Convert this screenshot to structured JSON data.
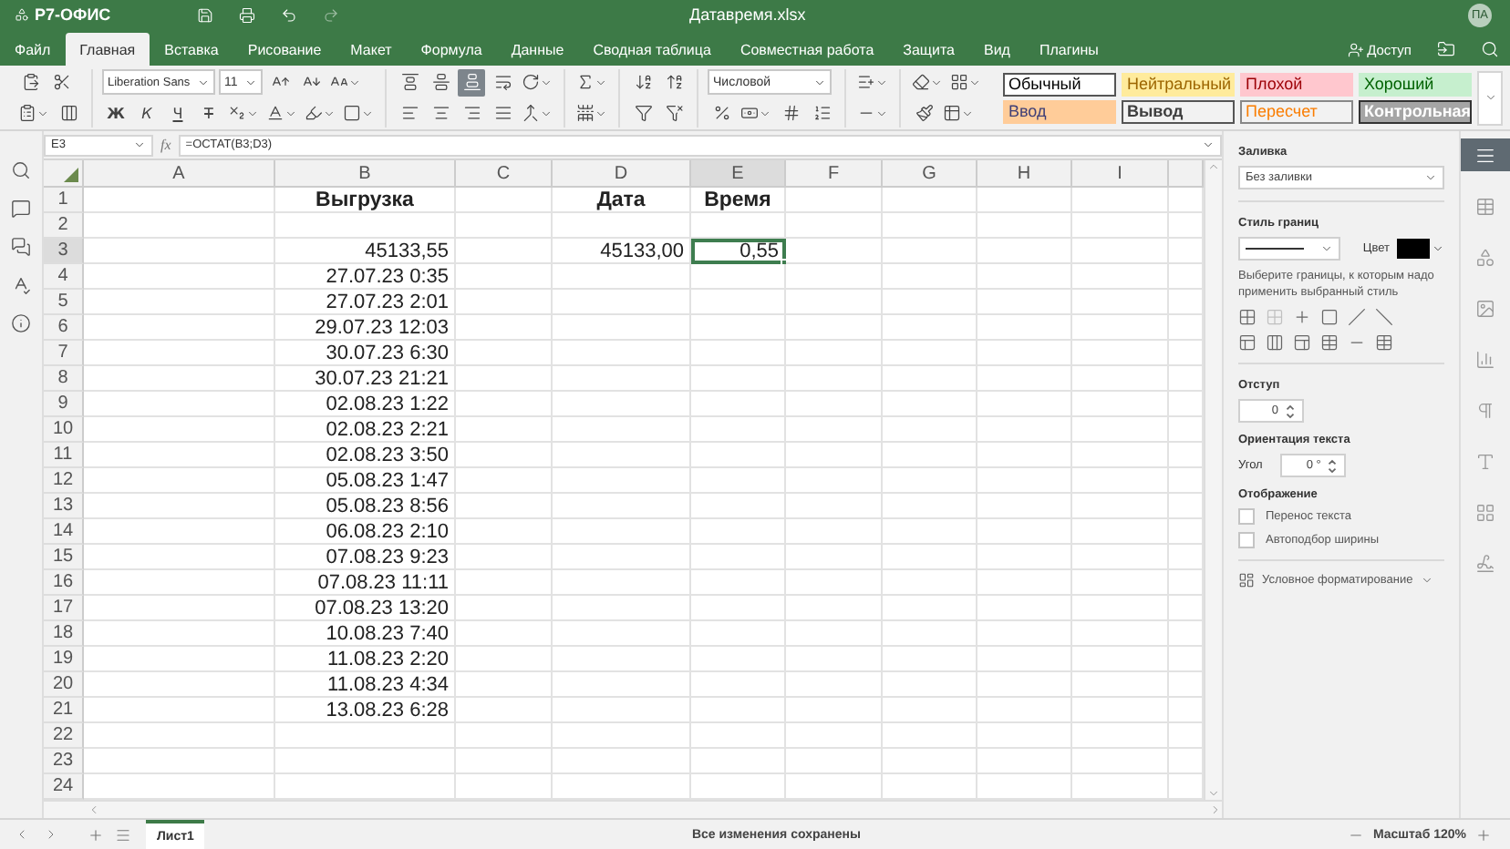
{
  "title_bar": {
    "app_name": "Р7-ОФИС",
    "document": "Датавремя.xlsx",
    "avatar": "ПА"
  },
  "menu_tabs": [
    {
      "label": "Файл",
      "selected": false
    },
    {
      "label": "Главная",
      "selected": true
    },
    {
      "label": "Вставка",
      "selected": false
    },
    {
      "label": "Рисование",
      "selected": false
    },
    {
      "label": "Макет",
      "selected": false
    },
    {
      "label": "Формула",
      "selected": false
    },
    {
      "label": "Данные",
      "selected": false
    },
    {
      "label": "Сводная таблица",
      "selected": false
    },
    {
      "label": "Совместная работа",
      "selected": false
    },
    {
      "label": "Защита",
      "selected": false
    },
    {
      "label": "Вид",
      "selected": false
    },
    {
      "label": "Плагины",
      "selected": false
    }
  ],
  "share_button": {
    "label": "Доступ"
  },
  "toolbar": {
    "font_name": "Liberation Sans",
    "font_size": "11",
    "format_letters": [
      "Ж",
      "К",
      "Ч",
      "Т"
    ],
    "vertical_align_buttons": [
      {
        "kind": "top",
        "selected": false
      },
      {
        "kind": "middle",
        "selected": false
      },
      {
        "kind": "bottom",
        "selected": true
      }
    ],
    "number_format": "Числовой",
    "cell_styles": [
      {
        "label": "Обычный",
        "color": "#ffffff",
        "kind": "normal"
      },
      {
        "label": "Нейтральный",
        "color": "#ffeb9c",
        "kind": "neutral"
      },
      {
        "label": "Плохой",
        "color": "#ffc7ce",
        "kind": "bad"
      },
      {
        "label": "Хороший",
        "color": "#c6efce",
        "kind": "good"
      },
      {
        "label": "Ввод",
        "color": "#ffcc99",
        "kind": "input"
      },
      {
        "label": "Вывод",
        "color": "#f2f2f2",
        "kind": "output"
      },
      {
        "label": "Пересчет",
        "color": "#f2f2f2",
        "kind": "calculation"
      },
      {
        "label": "Контрольная",
        "color": "#a5a5a5",
        "kind": "check"
      }
    ]
  },
  "formula_bar": {
    "cell": "E3",
    "fx": "fx",
    "formula": "=ОСТАТ(B3;D3)"
  },
  "sheet": {
    "columns": [
      {
        "letter": "A",
        "selected": false
      },
      {
        "letter": "B",
        "selected": false
      },
      {
        "letter": "C",
        "selected": false
      },
      {
        "letter": "D",
        "selected": false
      },
      {
        "letter": "E",
        "selected": true
      },
      {
        "letter": "F",
        "selected": false
      },
      {
        "letter": "G",
        "selected": false
      },
      {
        "letter": "H",
        "selected": false
      },
      {
        "letter": "I",
        "selected": false
      }
    ],
    "rows": [
      {
        "number": "1",
        "selected": false,
        "cells": {
          "B": {
            "text": "Выгрузка",
            "kind": "header",
            "selected": false
          },
          "D": {
            "text": "Дата",
            "kind": "header",
            "selected": false
          },
          "E": {
            "text": "Время",
            "kind": "header",
            "selected": false
          }
        }
      },
      {
        "number": "2",
        "selected": false
      },
      {
        "number": "3",
        "selected": true,
        "cells": {
          "B": {
            "text": "45133,55",
            "kind": "value",
            "selected": false
          },
          "D": {
            "text": "45133,00",
            "kind": "value",
            "selected": false
          },
          "E": {
            "text": "0,55",
            "kind": "value",
            "selected": true
          }
        }
      },
      {
        "number": "4",
        "selected": false,
        "cells": {
          "B": {
            "text": "27.07.23 0:35",
            "kind": "value",
            "selected": false
          }
        }
      },
      {
        "number": "5",
        "selected": false,
        "cells": {
          "B": {
            "text": "27.07.23 2:01",
            "kind": "value",
            "selected": false
          }
        }
      },
      {
        "number": "6",
        "selected": false,
        "cells": {
          "B": {
            "text": "29.07.23 12:03",
            "kind": "value",
            "selected": false
          }
        }
      },
      {
        "number": "7",
        "selected": false,
        "cells": {
          "B": {
            "text": "30.07.23 6:30",
            "kind": "value",
            "selected": false
          }
        }
      },
      {
        "number": "8",
        "selected": false,
        "cells": {
          "B": {
            "text": "30.07.23 21:21",
            "kind": "value",
            "selected": false
          }
        }
      },
      {
        "number": "9",
        "selected": false,
        "cells": {
          "B": {
            "text": "02.08.23 1:22",
            "kind": "value",
            "selected": false
          }
        }
      },
      {
        "number": "10",
        "selected": false,
        "cells": {
          "B": {
            "text": "02.08.23 2:21",
            "kind": "value",
            "selected": false
          }
        }
      },
      {
        "number": "11",
        "selected": false,
        "cells": {
          "B": {
            "text": "02.08.23 3:50",
            "kind": "value",
            "selected": false
          }
        }
      },
      {
        "number": "12",
        "selected": false,
        "cells": {
          "B": {
            "text": "05.08.23 1:47",
            "kind": "value",
            "selected": false
          }
        }
      },
      {
        "number": "13",
        "selected": false,
        "cells": {
          "B": {
            "text": "05.08.23 8:56",
            "kind": "value",
            "selected": false
          }
        }
      },
      {
        "number": "14",
        "selected": false,
        "cells": {
          "B": {
            "text": "06.08.23 2:10",
            "kind": "value",
            "selected": false
          }
        }
      },
      {
        "number": "15",
        "selected": false,
        "cells": {
          "B": {
            "text": "07.08.23 9:23",
            "kind": "value",
            "selected": false
          }
        }
      },
      {
        "number": "16",
        "selected": false,
        "cells": {
          "B": {
            "text": "07.08.23 11:11",
            "kind": "value",
            "selected": false
          }
        }
      },
      {
        "number": "17",
        "selected": false,
        "cells": {
          "B": {
            "text": "07.08.23 13:20",
            "kind": "value",
            "selected": false
          }
        }
      },
      {
        "number": "18",
        "selected": false,
        "cells": {
          "B": {
            "text": "10.08.23 7:40",
            "kind": "value",
            "selected": false
          }
        }
      },
      {
        "number": "19",
        "selected": false,
        "cells": {
          "B": {
            "text": "11.08.23 2:20",
            "kind": "value",
            "selected": false
          }
        }
      },
      {
        "number": "20",
        "selected": false,
        "cells": {
          "B": {
            "text": "11.08.23 4:34",
            "kind": "value",
            "selected": false
          }
        }
      },
      {
        "number": "21",
        "selected": false,
        "cells": {
          "B": {
            "text": "13.08.23 6:28",
            "kind": "value",
            "selected": false
          }
        }
      },
      {
        "number": "22",
        "selected": false
      },
      {
        "number": "23",
        "selected": false
      },
      {
        "number": "24",
        "selected": false
      }
    ]
  },
  "format_panel": {
    "fill_label": "Заливка",
    "fill_value": "Без заливки",
    "border_style_label": "Стиль границ",
    "color_label": "Цвет",
    "border_color": {
      "color": "#000000"
    },
    "border_hint": "Выберите границы, к которым надо применить выбранный стиль",
    "indent_label": "Отступ",
    "indent_value": "0",
    "orientation_label": "Ориентация текста",
    "angle_label": "Угол",
    "angle_value": "0 °",
    "display_label": "Отображение",
    "options": [
      {
        "label": "Перенос текста",
        "checked": false
      },
      {
        "label": "Автоподбор ширины",
        "checked": false
      }
    ],
    "conditional_formatting": "Условное форматирование"
  },
  "status_bar": {
    "sheet_tabs": [
      {
        "label": "Лист1",
        "selected": true
      }
    ],
    "message": "Все изменения сохранены",
    "zoom": "Масштаб 120%"
  }
}
